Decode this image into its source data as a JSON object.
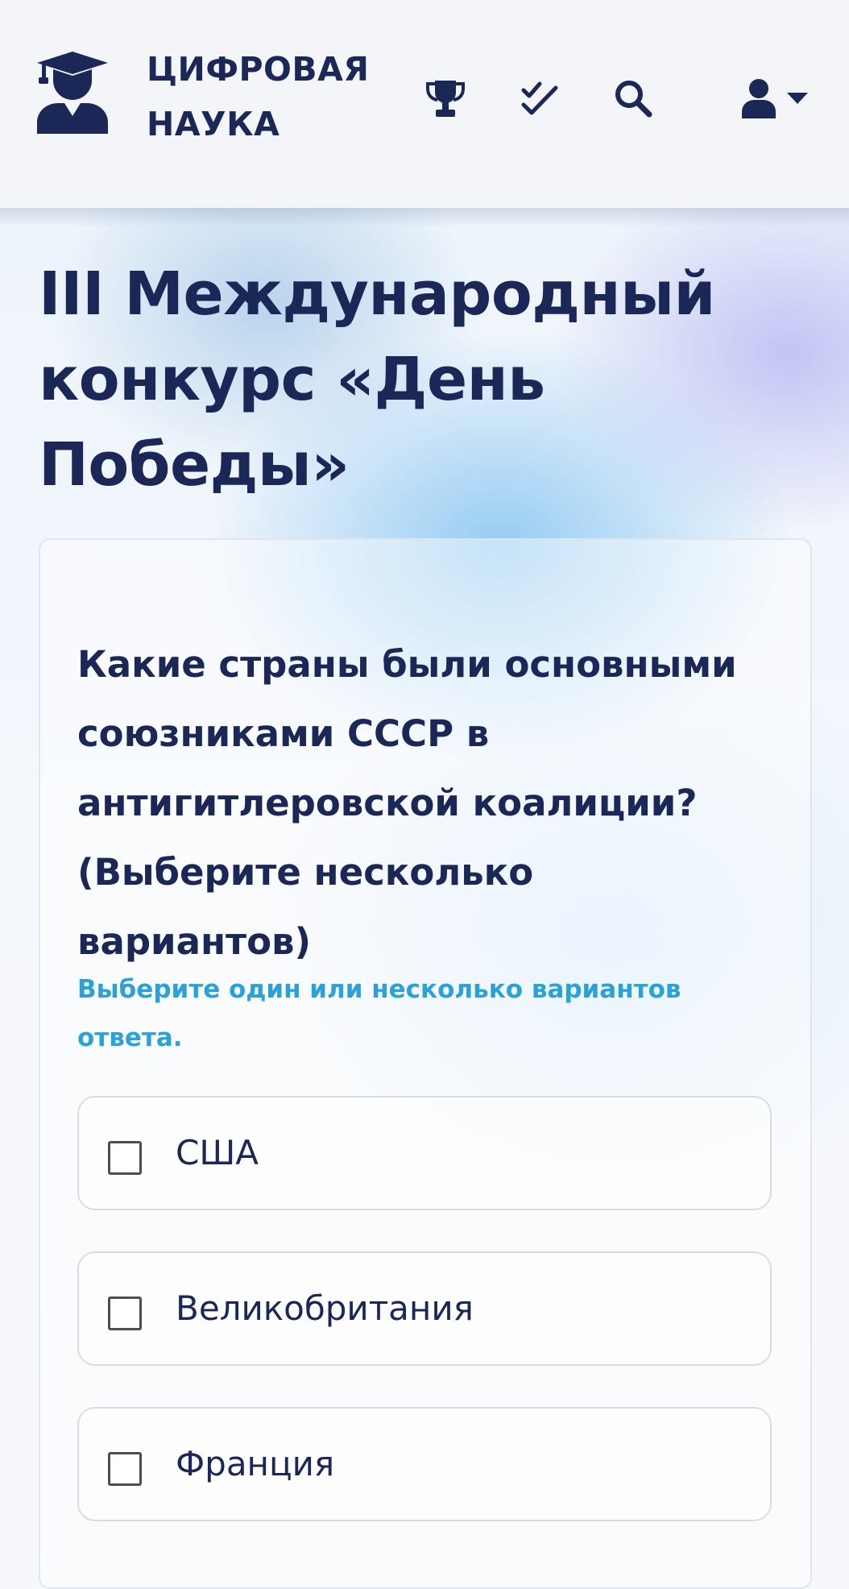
{
  "header": {
    "brand_line1": "ЦИФРОВАЯ",
    "brand_line2": "НАУКА",
    "icons": [
      "graduate-logo-icon",
      "trophy-icon",
      "double-check-icon",
      "search-icon",
      "user-icon",
      "caret-down-icon"
    ]
  },
  "main": {
    "title": "III Международный конкурс «День Победы»",
    "question": "Какие страны были основными союзниками СССР в антигитлеровской коалиции? (Выберите несколько вариантов)",
    "hint": "Выберите один или несколько вариантов ответа.",
    "options": [
      {
        "label": "США",
        "checked": false
      },
      {
        "label": "Великобритания",
        "checked": false
      },
      {
        "label": "Франция",
        "checked": false
      }
    ]
  },
  "colors": {
    "primary": "#1b2756",
    "hint": "#2aa2d8",
    "header_bg": "#f3f5f8"
  }
}
